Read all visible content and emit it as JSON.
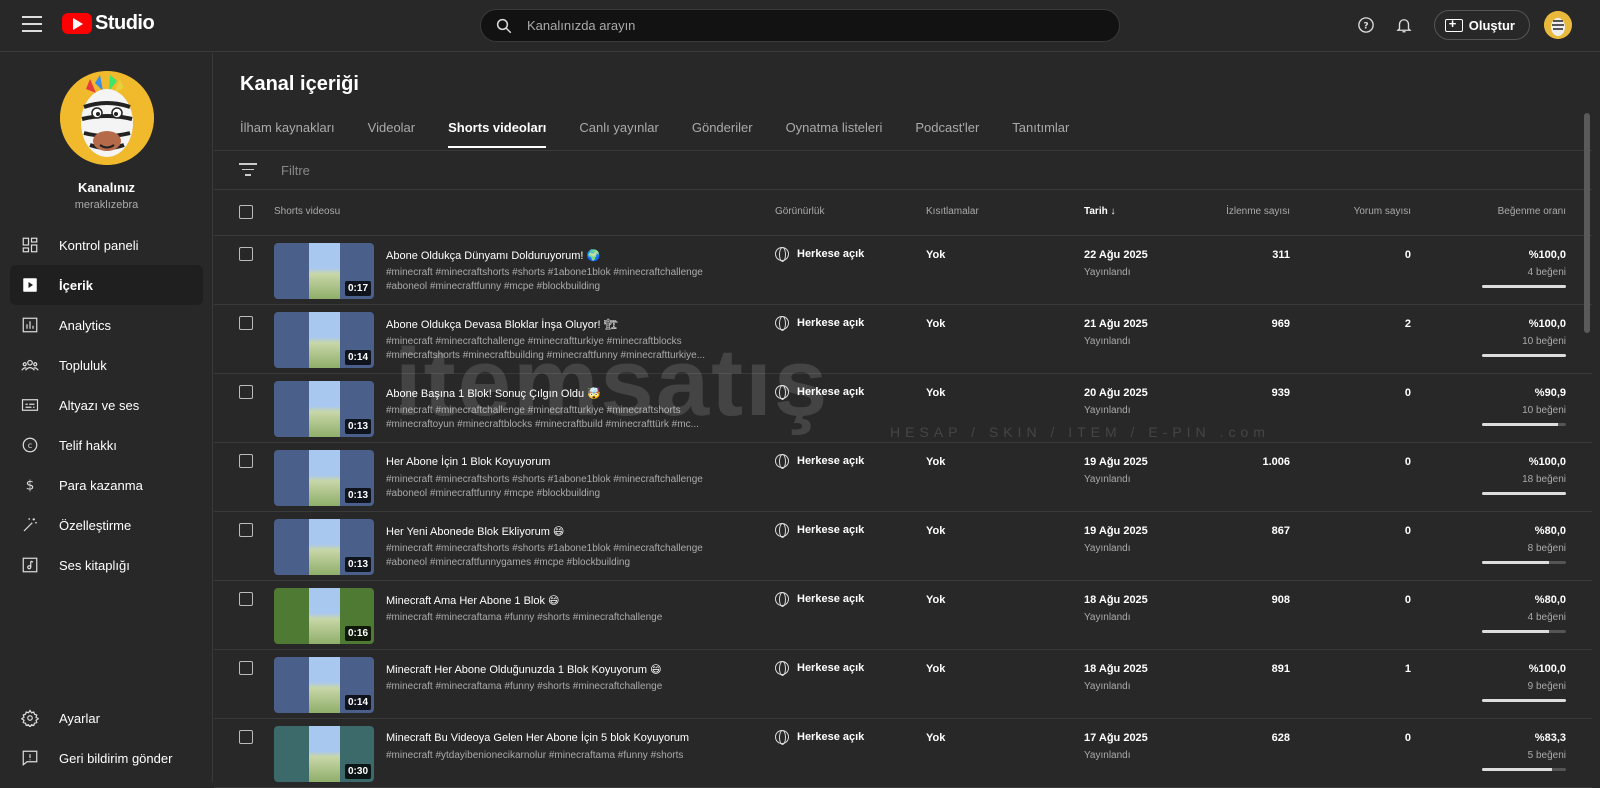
{
  "header": {
    "logo_text": "Studio",
    "search_placeholder": "Kanalınızda arayın",
    "create_label": "Oluştur"
  },
  "sidebar": {
    "channel_name": "Kanalınız",
    "channel_handle": "meraklızebra",
    "items": [
      {
        "label": "Kontrol paneli",
        "icon": "dashboard-icon"
      },
      {
        "label": "İçerik",
        "icon": "content-icon"
      },
      {
        "label": "Analytics",
        "icon": "analytics-icon"
      },
      {
        "label": "Topluluk",
        "icon": "community-icon"
      },
      {
        "label": "Altyazı ve ses",
        "icon": "subtitles-icon"
      },
      {
        "label": "Telif hakkı",
        "icon": "copyright-icon"
      },
      {
        "label": "Para kazanma",
        "icon": "dollar-icon"
      },
      {
        "label": "Özelleştirme",
        "icon": "magic-wand-icon"
      },
      {
        "label": "Ses kitaplığı",
        "icon": "audio-library-icon"
      }
    ],
    "bottom_items": [
      {
        "label": "Ayarlar",
        "icon": "gear-icon"
      },
      {
        "label": "Geri bildirim gönder",
        "icon": "feedback-icon"
      }
    ]
  },
  "main": {
    "title": "Kanal içeriği",
    "tabs": [
      "İlham kaynakları",
      "Videolar",
      "Shorts videoları",
      "Canlı yayınlar",
      "Gönderiler",
      "Oynatma listeleri",
      "Podcast'ler",
      "Tanıtımlar"
    ],
    "active_tab": "Shorts videoları",
    "filter_placeholder": "Filtre",
    "columns": {
      "video": "Shorts videosu",
      "visibility": "Görünürlük",
      "restrictions": "Kısıtlamalar",
      "date": "Tarih",
      "views": "İzlenme sayısı",
      "comments": "Yorum sayısı",
      "likes": "Beğenme oranı"
    }
  },
  "rows": [
    {
      "title": "Abone Oldukça Dünyamı Dolduruyorum! 🌍",
      "desc": "#minecraft #minecraftshorts #shorts #1abone1blok #minecraftchallenge #aboneol #minecraftfunny #mcpe #blockbuilding",
      "duration": "0:17",
      "visibility": "Herkese açık",
      "restrictions": "Yok",
      "date": "22 Ağu 2025",
      "status": "Yayınlandı",
      "views": "311",
      "comments": "0",
      "ratio": "%100,0",
      "likes": "4 beğeni",
      "ratio_value": 1.0,
      "thumb_color": "#4a5f8a"
    },
    {
      "title": "Abone Oldukça Devasa Bloklar İnşa Oluyor! 🏗",
      "desc": "#minecraft #minecraftchallenge #minecraftturkiye #minecraftblocks #minecraftshorts #minecraftbuilding #minecraftfunny #minecraftturkiye...",
      "duration": "0:14",
      "visibility": "Herkese açık",
      "restrictions": "Yok",
      "date": "21 Ağu 2025",
      "status": "Yayınlandı",
      "views": "969",
      "comments": "2",
      "ratio": "%100,0",
      "likes": "10 beğeni",
      "ratio_value": 1.0,
      "thumb_color": "#4a5f8a"
    },
    {
      "title": "Abone Başına 1 Blok! Sonuç Çılgın Oldu 🤯",
      "desc": "#minecraft #minecraftchallenge #minecraftturkiye #minecraftshorts #minecraftoyun #minecraftblocks #minecraftbuild #minecrafttürk #mc...",
      "duration": "0:13",
      "visibility": "Herkese açık",
      "restrictions": "Yok",
      "date": "20 Ağu 2025",
      "status": "Yayınlandı",
      "views": "939",
      "comments": "0",
      "ratio": "%90,9",
      "likes": "10 beğeni",
      "ratio_value": 0.909,
      "thumb_color": "#4a5f8a"
    },
    {
      "title": "Her Abone İçin 1 Blok Koyuyorum",
      "desc": "#minecraft #minecraftshorts #shorts #1abone1blok #minecraftchallenge #aboneol #minecraftfunny #mcpe #blockbuilding",
      "duration": "0:13",
      "visibility": "Herkese açık",
      "restrictions": "Yok",
      "date": "19 Ağu 2025",
      "status": "Yayınlandı",
      "views": "1.006",
      "comments": "0",
      "ratio": "%100,0",
      "likes": "18 beğeni",
      "ratio_value": 1.0,
      "thumb_color": "#4a5f8a"
    },
    {
      "title": "Her Yeni Abonede Blok Ekliyorum 😄",
      "desc": "#minecraft #minecraftshorts #shorts #1abone1blok #minecraftchallenge #aboneol #minecraftfunnygames #mcpe #blockbuilding",
      "duration": "0:13",
      "visibility": "Herkese açık",
      "restrictions": "Yok",
      "date": "19 Ağu 2025",
      "status": "Yayınlandı",
      "views": "867",
      "comments": "0",
      "ratio": "%80,0",
      "likes": "8 beğeni",
      "ratio_value": 0.8,
      "thumb_color": "#4a5f8a"
    },
    {
      "title": "Minecraft Ama Her Abone 1 Blok 😄",
      "desc": "#minecraft #minecraftama #funny #shorts #minecraftchallenge",
      "duration": "0:16",
      "visibility": "Herkese açık",
      "restrictions": "Yok",
      "date": "18 Ağu 2025",
      "status": "Yayınlandı",
      "views": "908",
      "comments": "0",
      "ratio": "%80,0",
      "likes": "4 beğeni",
      "ratio_value": 0.8,
      "thumb_color": "#4f7a34"
    },
    {
      "title": "Minecraft Her Abone Olduğunuzda 1 Blok Koyuyorum 😄",
      "desc": "#minecraft #minecraftama #funny #shorts #minecraftchallenge",
      "duration": "0:14",
      "visibility": "Herkese açık",
      "restrictions": "Yok",
      "date": "18 Ağu 2025",
      "status": "Yayınlandı",
      "views": "891",
      "comments": "1",
      "ratio": "%100,0",
      "likes": "9 beğeni",
      "ratio_value": 1.0,
      "thumb_color": "#4a5f8a"
    },
    {
      "title": "Minecraft Bu Videoya Gelen Her Abone İçin 5 blok Koyuyorum",
      "desc": "#minecraft #ytdayibenionecikarnolur #minecraftama #funny #shorts",
      "duration": "0:30",
      "visibility": "Herkese açık",
      "restrictions": "Yok",
      "date": "17 Ağu 2025",
      "status": "Yayınlandı",
      "views": "628",
      "comments": "0",
      "ratio": "%83,3",
      "likes": "5 beğeni",
      "ratio_value": 0.833,
      "thumb_color": "#3c6a6a"
    }
  ],
  "watermark": {
    "main": "itemsatış",
    "sub": "HESAP / SKIN / ITEM / E-PIN .com"
  }
}
